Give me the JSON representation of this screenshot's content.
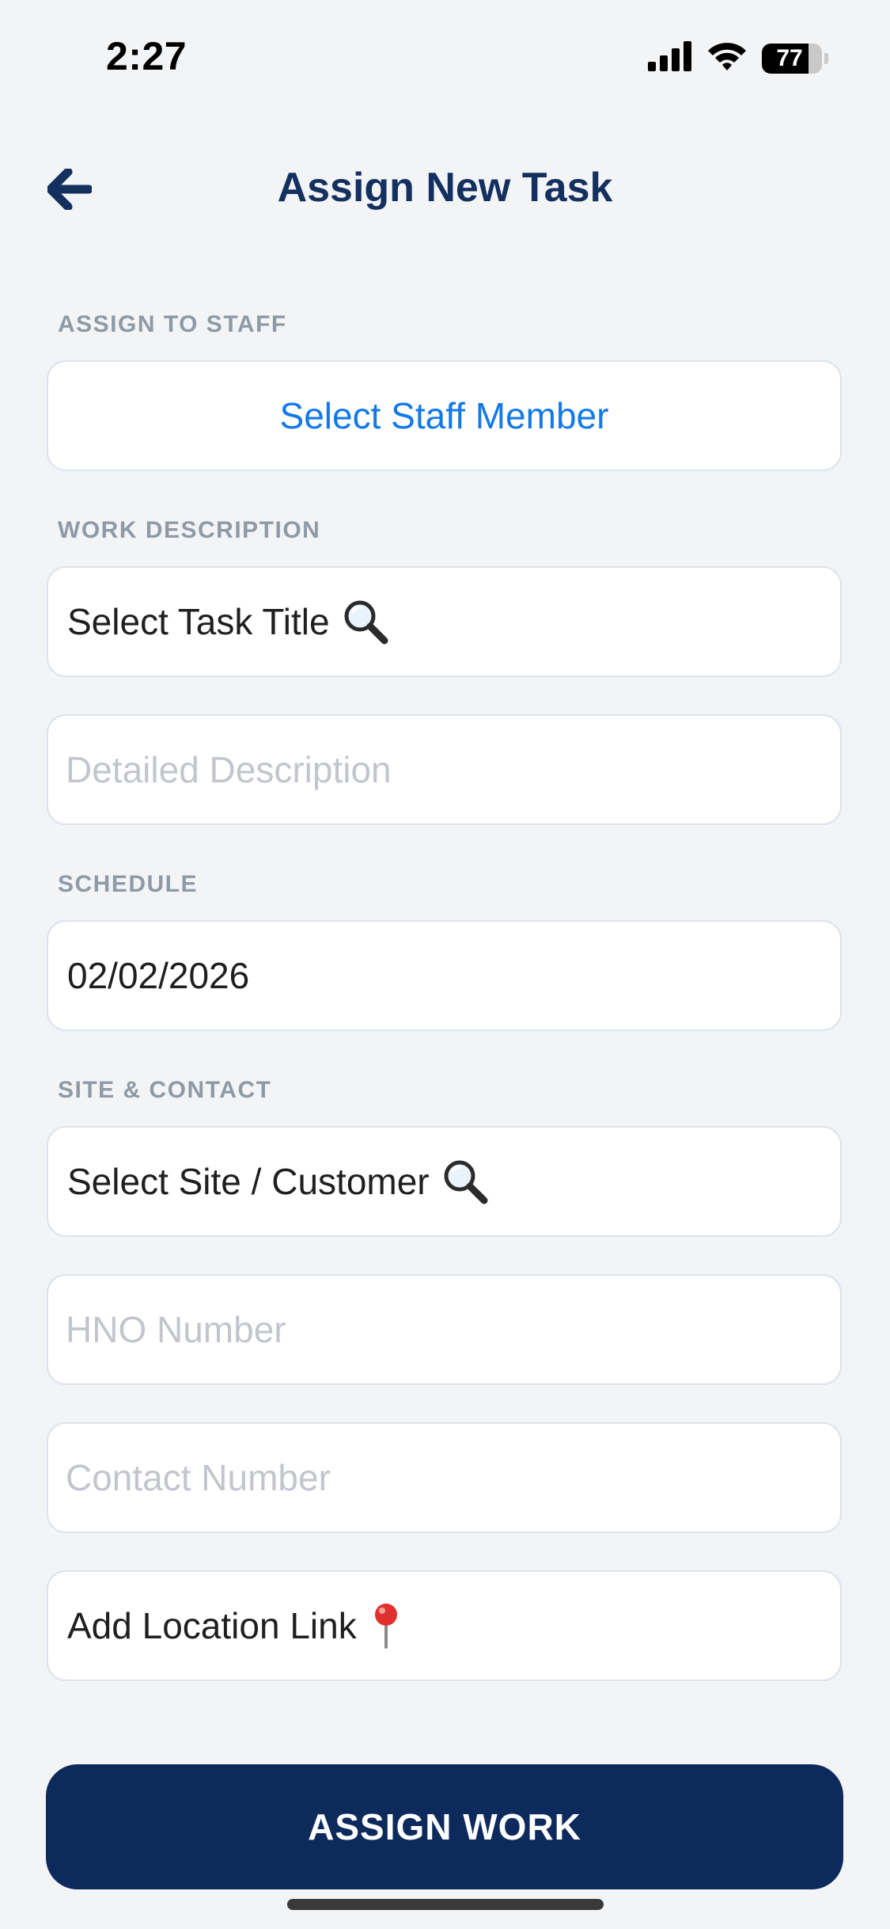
{
  "status_bar": {
    "time": "2:27",
    "battery": "77",
    "battery_level": 0.77
  },
  "header": {
    "title": "Assign New Task"
  },
  "sections": {
    "staff": {
      "label": "ASSIGN TO STAFF",
      "select_label": "Select Staff Member"
    },
    "work": {
      "label": "WORK DESCRIPTION",
      "task_title": "Select Task Title",
      "description_placeholder": "Detailed Description"
    },
    "schedule": {
      "label": "SCHEDULE",
      "date": "02/02/2026"
    },
    "site": {
      "label": "SITE & CONTACT",
      "site_select": "Select Site / Customer",
      "hno_placeholder": "HNO Number",
      "contact_placeholder": "Contact Number",
      "location_link": "Add Location Link"
    }
  },
  "actions": {
    "assign_label": "ASSIGN WORK"
  },
  "colors": {
    "primary": "#0d2a5c",
    "title": "#14305e",
    "link": "#1479e8",
    "label": "#8e9aa6",
    "background": "#f3f4f6"
  },
  "icons": {
    "back": "arrow-left-icon",
    "search": "magnifier-icon",
    "location": "pushpin-icon"
  }
}
